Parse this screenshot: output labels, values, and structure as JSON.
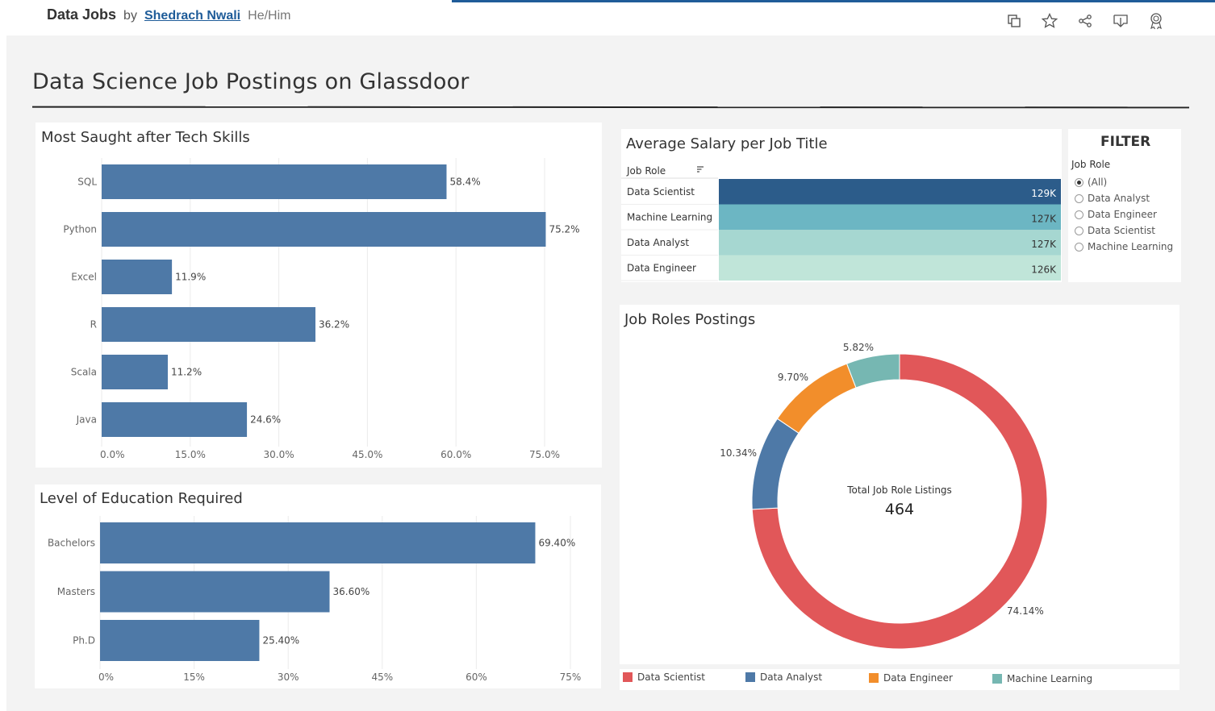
{
  "header": {
    "workbook_title": "Data Jobs",
    "by": "by",
    "author": "Shedrach Nwali",
    "pronouns": "He/Him",
    "icons": [
      "copy-icon",
      "star-icon",
      "share-icon",
      "download-icon",
      "badge-icon"
    ]
  },
  "dashboard": {
    "title": "Data Science Job Postings on Glassdoor"
  },
  "skills": {
    "title": "Most Saught after Tech Skills",
    "chart_data": {
      "type": "bar",
      "orientation": "horizontal",
      "categories": [
        "SQL",
        "Python",
        "Excel",
        "R",
        "Scala",
        "Java"
      ],
      "values": [
        58.4,
        75.2,
        11.9,
        36.2,
        11.2,
        24.6
      ],
      "value_labels": [
        "58.4%",
        "75.2%",
        "11.9%",
        "36.2%",
        "11.2%",
        "24.6%"
      ],
      "xticks": [
        "0.0%",
        "15.0%",
        "30.0%",
        "45.0%",
        "60.0%",
        "75.0%"
      ],
      "xlim": [
        0,
        75
      ],
      "color": "#4e79a7",
      "grid": true
    }
  },
  "education": {
    "title": "Level of Education Required",
    "chart_data": {
      "type": "bar",
      "orientation": "horizontal",
      "categories": [
        "Bachelors",
        "Masters",
        "Ph.D"
      ],
      "values": [
        69.4,
        36.6,
        25.4
      ],
      "value_labels": [
        "69.40%",
        "36.60%",
        "25.40%"
      ],
      "xticks": [
        "0%",
        "15%",
        "30%",
        "45%",
        "60%",
        "75%"
      ],
      "xlim": [
        0,
        75
      ],
      "color": "#4e79a7",
      "grid": true
    }
  },
  "salary": {
    "title": "Average Salary per Job Title",
    "column_header": "Job Role",
    "chart_data": {
      "type": "table",
      "rows": [
        {
          "role": "Data Scientist",
          "value": 129,
          "label": "129K",
          "color": "#2c5c8a"
        },
        {
          "role": "Machine Learning",
          "value": 127,
          "label": "127K",
          "color": "#6cb6c3"
        },
        {
          "role": "Data Analyst",
          "value": 127,
          "label": "127K",
          "color": "#a6d7d1"
        },
        {
          "role": "Data Engineer",
          "value": 126,
          "label": "126K",
          "color": "#c0e5d9"
        }
      ]
    }
  },
  "filter": {
    "title": "FILTER",
    "label": "Job Role",
    "options": [
      "(All)",
      "Data Analyst",
      "Data Engineer",
      "Data Scientist",
      "Machine Learning"
    ],
    "selected": "(All)"
  },
  "postings": {
    "title": "Job Roles Postings",
    "center_label": "Total Job Role Listings",
    "center_value": "464",
    "chart_data": {
      "type": "pie",
      "donut": true,
      "slices": [
        {
          "name": "Data Scientist",
          "value": 74.14,
          "label": "74.14%",
          "color": "#e15759"
        },
        {
          "name": "Data Analyst",
          "value": 10.34,
          "label": "10.34%",
          "color": "#4e79a7"
        },
        {
          "name": "Data Engineer",
          "value": 9.7,
          "label": "9.70%",
          "color": "#f28e2b"
        },
        {
          "name": "Machine Learning",
          "value": 5.82,
          "label": "5.82%",
          "color": "#76b7b2"
        }
      ],
      "legend_position": "bottom"
    }
  }
}
